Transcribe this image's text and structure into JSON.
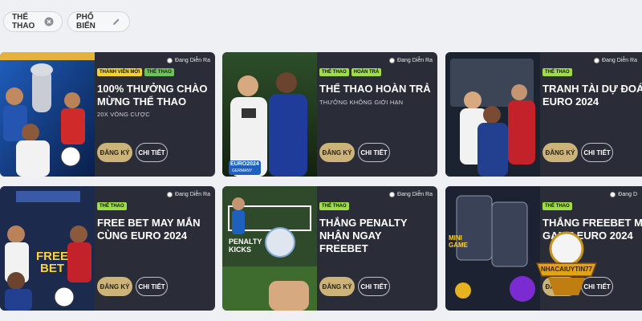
{
  "filters": {
    "sports_label": "THỂ THAO",
    "popular_label": "PHỔ BIẾN"
  },
  "cards": [
    {
      "tags": [
        "THÀNH VIÊN MỚI",
        "THỂ THAO"
      ],
      "live": "Đang Diễn Ra",
      "title": "100% THƯỞNG CHÀO MỪNG THỂ THAO",
      "subtitle": "20X VÒNG CƯỢC",
      "register": "ĐĂNG KÝ",
      "details": "CHI TIẾT"
    },
    {
      "tags": [
        "THỂ THAO",
        "HOÀN TRẢ"
      ],
      "live": "Đang Diễn Ra",
      "title": "THỂ THAO HOÀN TRẢ",
      "subtitle": "THƯỞNG KHÔNG GIỚI HẠN",
      "register": "ĐĂNG KÝ",
      "details": "CHI TIẾT"
    },
    {
      "tags": [
        "THỂ THAO"
      ],
      "live": "Đang Diễn Ra",
      "title": "TRANH TÀI DỰ ĐOÁN EURO 2024",
      "subtitle": "",
      "register": "ĐĂNG KÝ",
      "details": "CHI TIẾT"
    },
    {
      "tags": [
        "THỂ THAO"
      ],
      "live": "Đang Diễn Ra",
      "title": "FREE BET MAY MẮN CÙNG EURO 2024",
      "subtitle": "",
      "register": "ĐĂNG KÝ",
      "details": "CHI TIẾT"
    },
    {
      "tags": [
        "THỂ THAO"
      ],
      "live": "Đang Diễn Ra",
      "title": "THẮNG PENALTY NHẬN NGAY FREEBET",
      "subtitle": "",
      "register": "ĐĂNG KÝ",
      "details": "CHI TIẾT"
    },
    {
      "tags": [
        "THỂ THAO"
      ],
      "live": "Đang D",
      "title": "THẮNG FREEBET MI GAME EURO 2024",
      "subtitle": "",
      "register": "ĐĂNG KÝ",
      "details": "CHI TIẾT"
    }
  ],
  "art_text": {
    "euro_logo": "EURO2024",
    "euro_logo_sub": "GERMANY",
    "free_bet": "FREE BET",
    "penalty_kicks": "PENALTY KICKS",
    "mini_game": "MINI GAME",
    "watermark": "NHACAIUYTIN77"
  },
  "colors": {
    "page_bg": "#eef0f3",
    "card_bg": "#2a2d38",
    "accent_gold": "#cbb37a",
    "tag_green": "#9fdc4a",
    "tag_yellow": "#f5d233"
  }
}
